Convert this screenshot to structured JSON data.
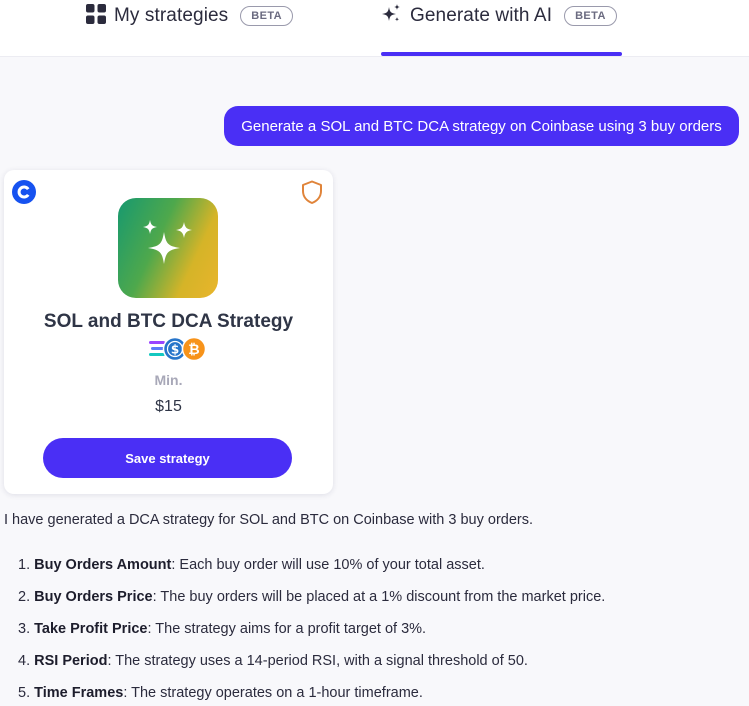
{
  "tabs": [
    {
      "label": "My strategies",
      "badge": "BETA",
      "icon": "grid-icon"
    },
    {
      "label": "Generate with AI",
      "badge": "BETA",
      "icon": "sparkles-icon",
      "active": true
    }
  ],
  "chat": {
    "user_message": "Generate a SOL and BTC DCA strategy on Coinbase using 3 buy orders"
  },
  "card": {
    "title": "SOL and BTC DCA Strategy",
    "min_label": "Min.",
    "min_value": "$15",
    "save_label": "Save strategy",
    "exchange_icon": "coinbase-logo",
    "shield_icon": "shield-icon"
  },
  "response": {
    "intro": "I have generated a DCA strategy for SOL and BTC on Coinbase with 3 buy orders.",
    "items": [
      {
        "num": "1.",
        "term": "Buy Orders Amount",
        "text": ": Each buy order will use 10% of your total asset."
      },
      {
        "num": "2.",
        "term": "Buy Orders Price",
        "text": ": The buy orders will be placed at a 1% discount from the market price."
      },
      {
        "num": "3.",
        "term": "Take Profit Price",
        "text": ": The strategy aims for a profit target of 3%."
      },
      {
        "num": "4.",
        "term": "RSI Period",
        "text": ": The strategy uses a 14-period RSI, with a signal threshold of 50."
      },
      {
        "num": "5.",
        "term": "Time Frames",
        "text": ": The strategy operates on a 1-hour timeframe."
      }
    ]
  },
  "colors": {
    "accent": "#4a2ff5",
    "coinbase": "#1652f0",
    "shield": "#e0843a",
    "btc": "#f7931a"
  }
}
